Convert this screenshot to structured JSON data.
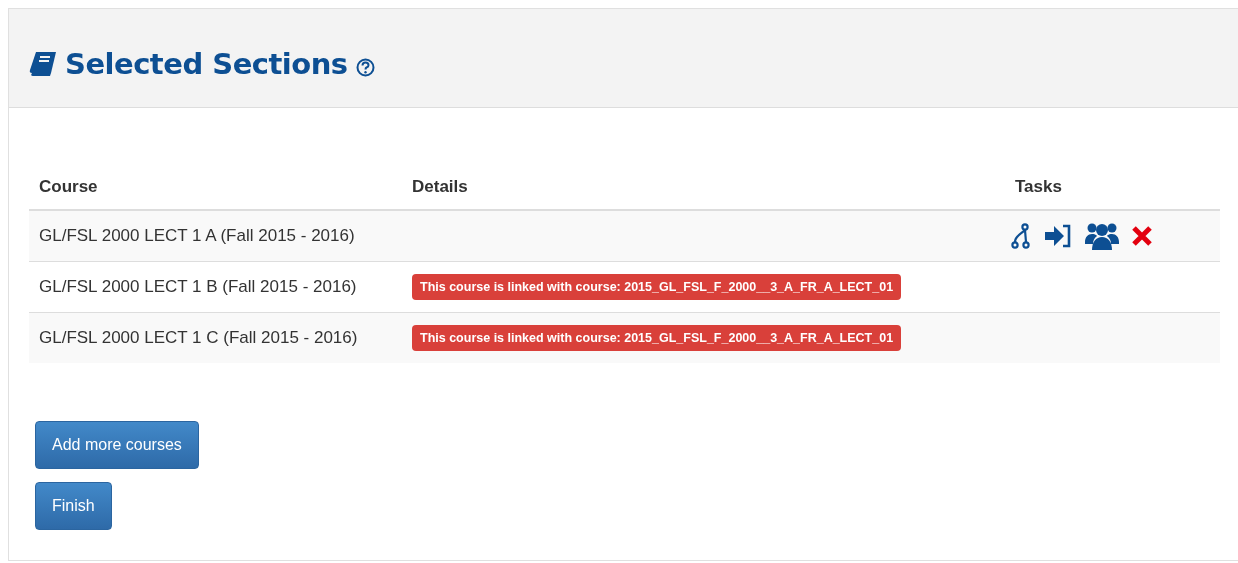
{
  "title": "Selected Sections",
  "table": {
    "columns": [
      "Course",
      "Details",
      "Tasks"
    ],
    "rows": [
      {
        "course": "GL/FSL 2000 LECT 1 A (Fall 2015 - 2016)",
        "detail": null,
        "has_tasks": true
      },
      {
        "course": "GL/FSL 2000 LECT 1 B (Fall 2015 - 2016)",
        "detail": "This course is linked with course: 2015_GL_FSL_F_2000__3_A_FR_A_LECT_01",
        "has_tasks": false
      },
      {
        "course": "GL/FSL 2000 LECT 1 C (Fall 2015 - 2016)",
        "detail": "This course is linked with course: 2015_GL_FSL_F_2000__3_A_FR_A_LECT_01",
        "has_tasks": false
      }
    ]
  },
  "buttons": [
    "Add more courses",
    "Finish"
  ]
}
